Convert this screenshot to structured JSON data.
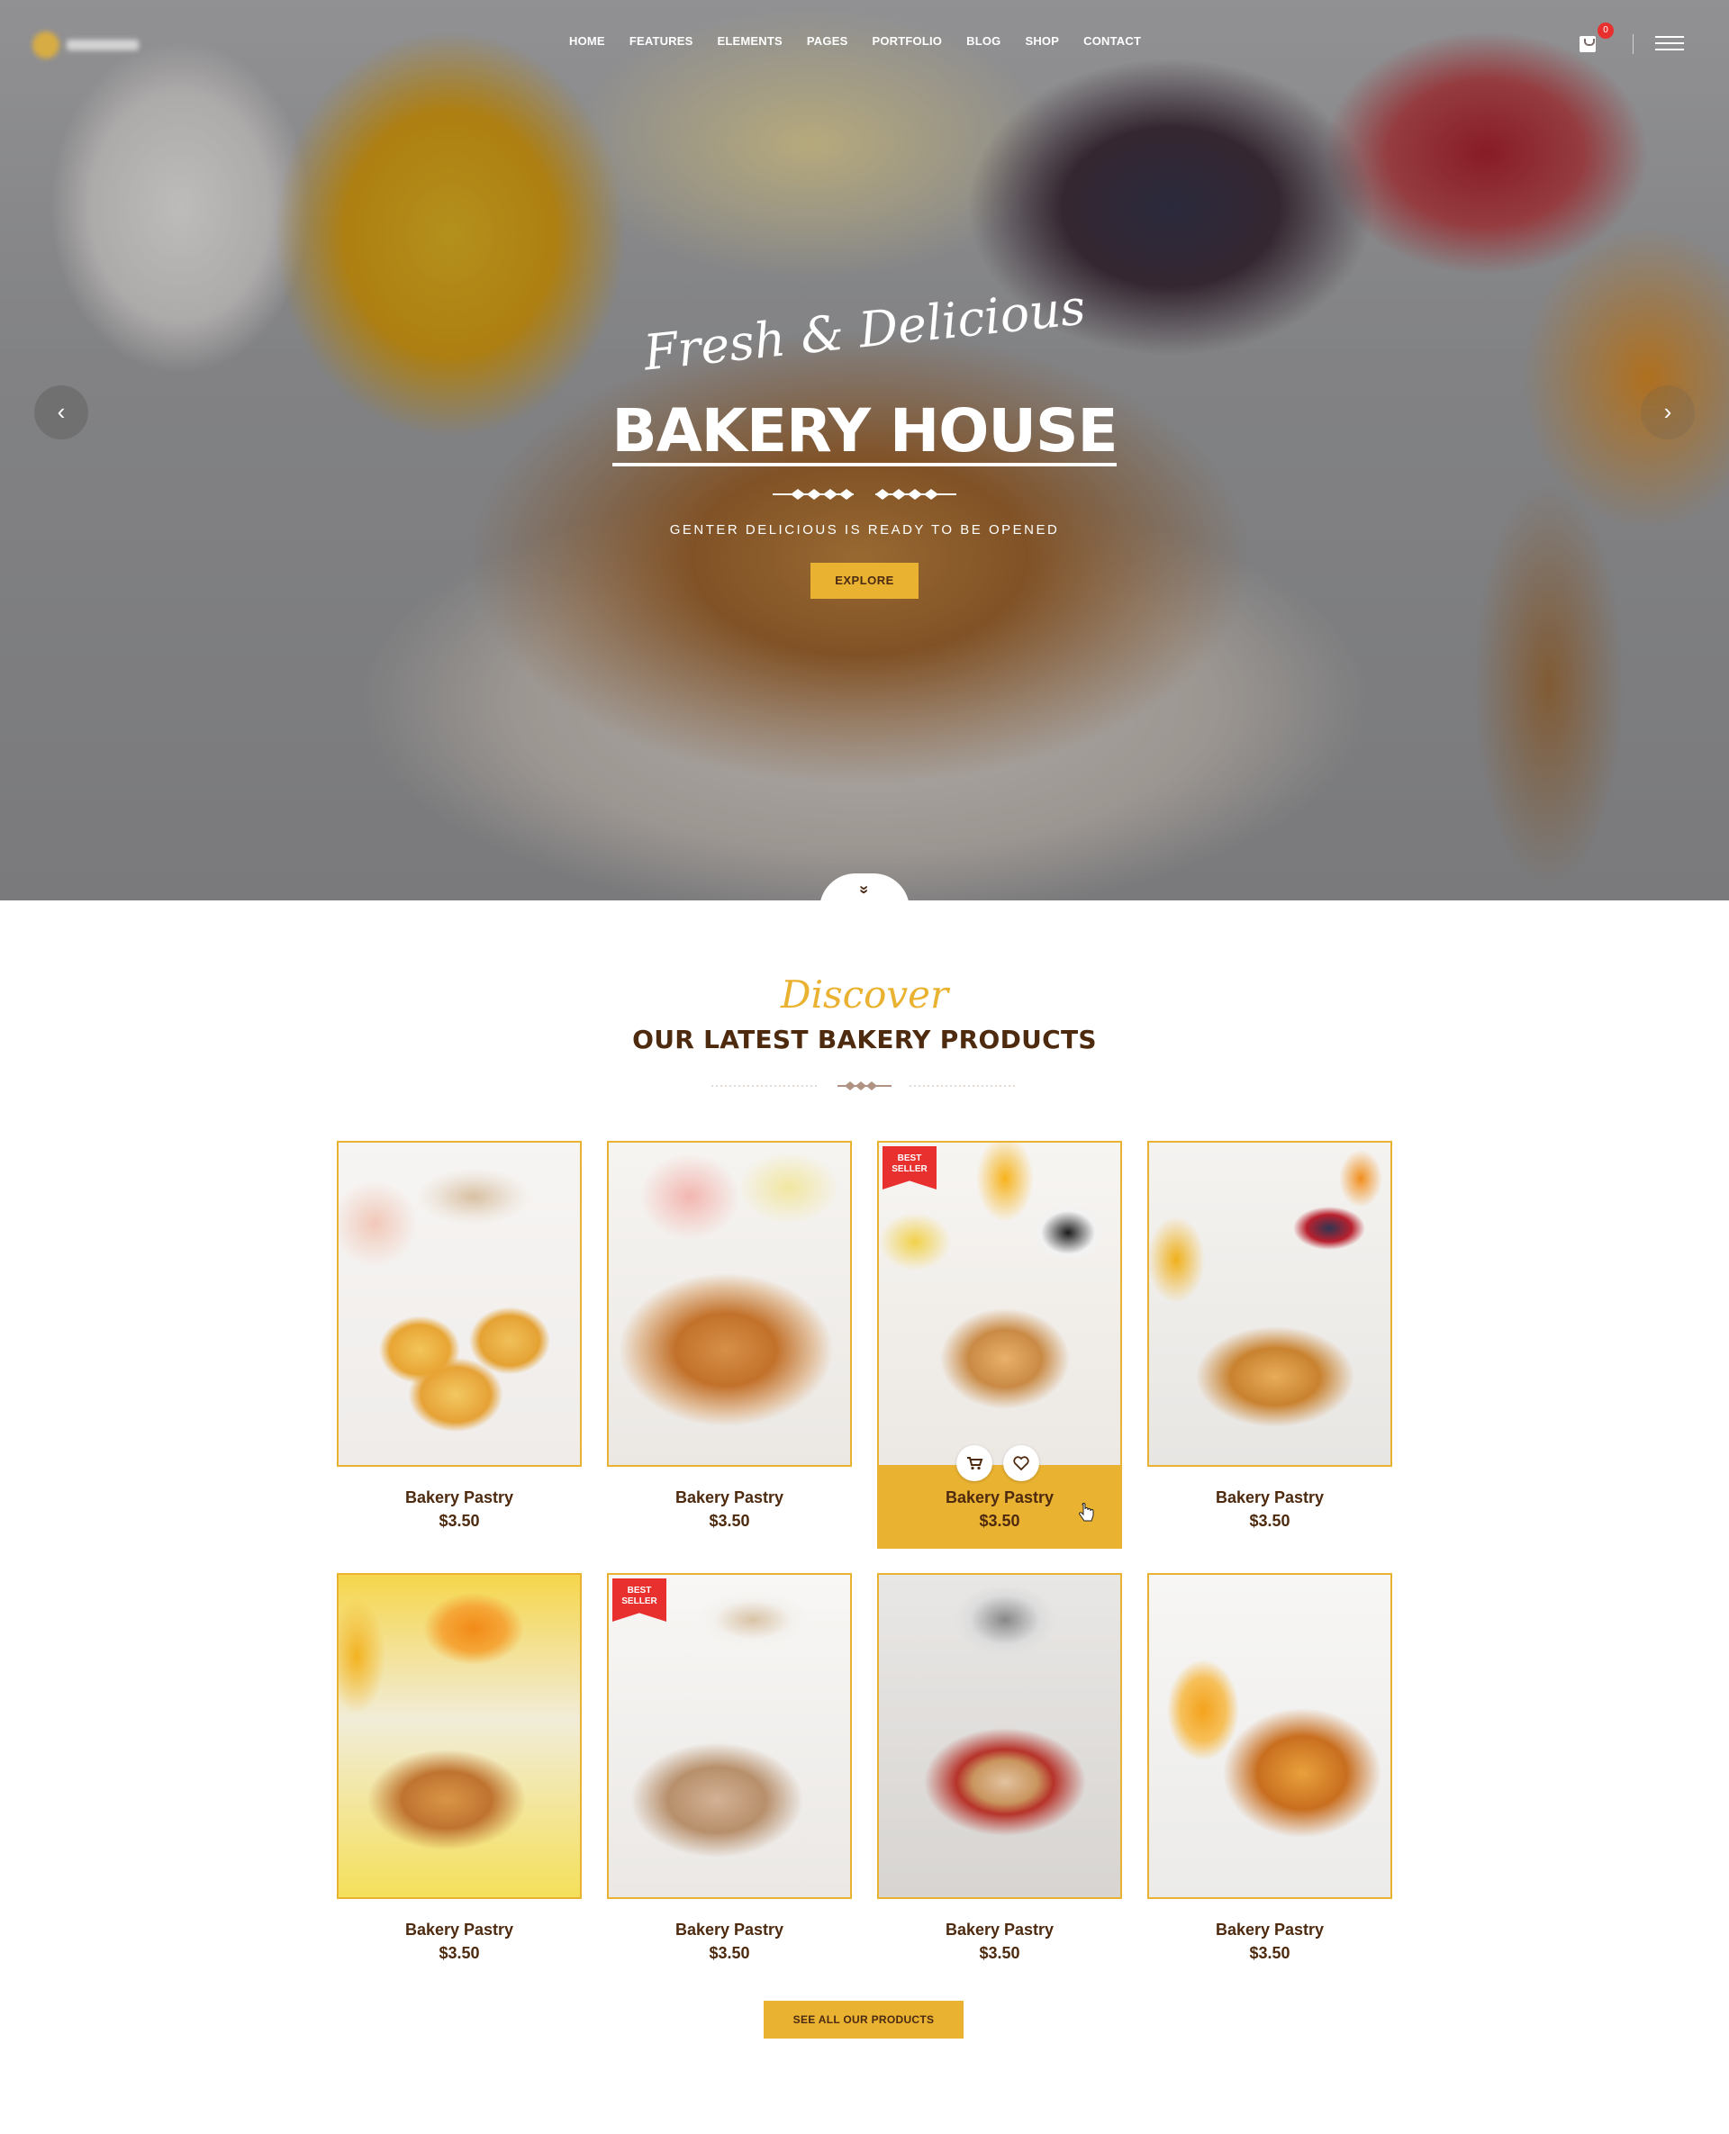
{
  "nav": {
    "items": [
      "HOME",
      "FEATURES",
      "ELEMENTS",
      "PAGES",
      "PORTFOLIO",
      "BLOG",
      "SHOP",
      "CONTACT"
    ],
    "cart_count": "0"
  },
  "hero": {
    "script_text": "Fresh & Delicious",
    "title": "BAKERY HOUSE",
    "subtitle": "GENTER DELICIOUS IS READY TO BE OPENED",
    "button_label": "EXPLORE",
    "prev_arrow": "‹",
    "next_arrow": "›",
    "scroll_icon": "»"
  },
  "products_section": {
    "script_text": "Discover",
    "title": "OUR LATEST BAKERY PRODUCTS",
    "badge_text": "BEST SELLER",
    "button_label": "SEE ALL OUR PRODUCTS",
    "products": [
      {
        "name": "Bakery Pastry",
        "price": "$3.50"
      },
      {
        "name": "Bakery Pastry",
        "price": "$3.50"
      },
      {
        "name": "Bakery Pastry",
        "price": "$3.50"
      },
      {
        "name": "Bakery Pastry",
        "price": "$3.50"
      },
      {
        "name": "Bakery Pastry",
        "price": "$3.50"
      },
      {
        "name": "Bakery Pastry",
        "price": "$3.50"
      },
      {
        "name": "Bakery Pastry",
        "price": "$3.50"
      },
      {
        "name": "Bakery Pastry",
        "price": "$3.50"
      }
    ]
  },
  "colors": {
    "accent": "#eab231",
    "dark_brown": "#4e2a0f",
    "badge_red": "#e8302f"
  },
  "icons": [
    "cart-icon",
    "menu-icon",
    "chevron-left-icon",
    "chevron-right-icon",
    "chevron-double-down-icon",
    "wheat-icon",
    "add-to-cart-icon",
    "heart-icon",
    "hand-cursor-icon"
  ]
}
